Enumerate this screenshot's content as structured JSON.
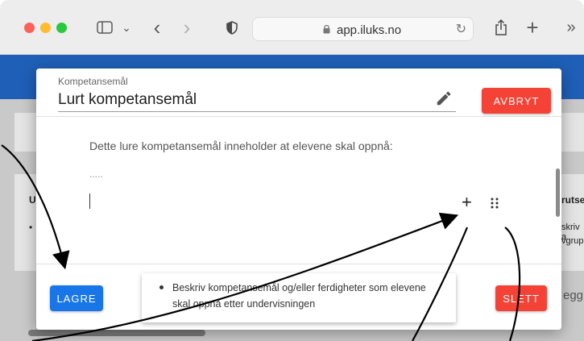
{
  "browser": {
    "url": "app.iluks.no",
    "icons": [
      "sidebar-toggle-icon",
      "chevron-down-icon",
      "back-icon",
      "forward-icon",
      "shield-icon",
      "lock-icon",
      "reload-icon",
      "share-icon",
      "new-tab-icon",
      "overflow-icon"
    ],
    "glyphs": {
      "chevron": "⌄",
      "back": "‹",
      "forward": "›",
      "reload": "↻",
      "share": "⇧",
      "plus": "+",
      "more": "»"
    }
  },
  "background": {
    "partial_texts": [
      "U",
      "•",
      "rutse",
      "skriv a",
      "vgrup",
      "egg"
    ],
    "appbar_color": "#1f5fb7"
  },
  "dialog": {
    "field_label": "Kompetansemål",
    "field_value": "Lurt kompetansemål",
    "cancel_label": "AVBRYT",
    "editor_line1": "Dette lure kompetansemål inneholder at elevene skal oppnå:",
    "editor_line2": ".....",
    "add_glyph": "+",
    "save_label": "LAGRE",
    "delete_label": "SLETT",
    "tooltip_text": "Beskriv kompetansemål og/eller ferdigheter som elevene skal oppnå etter undervisningen"
  },
  "colors": {
    "primary": "#1976e8",
    "danger": "#f44336"
  }
}
